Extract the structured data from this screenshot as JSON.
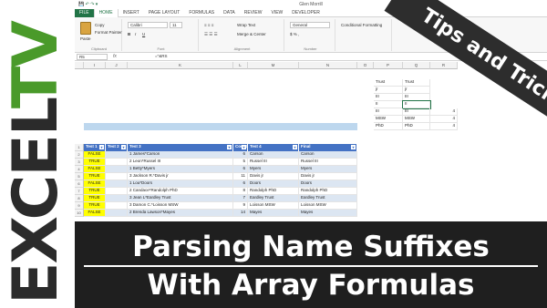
{
  "brand": {
    "excel": "EXCEL",
    "tv": "TV",
    "colors": {
      "excel": "#2b2b2b",
      "tv": "#4a9a2a"
    }
  },
  "window": {
    "title": "Glen Morrill",
    "user": "Christy Sellell",
    "file_tab": "FILE",
    "tabs": [
      "HOME",
      "INSERT",
      "PAGE LAYOUT",
      "FORMULAS",
      "DATA",
      "REVIEW",
      "VIEW",
      "DEVELOPER"
    ],
    "active_tab": "HOME",
    "accent_color": "#217346"
  },
  "ribbon": {
    "clipboard": {
      "label": "Clipboard",
      "paste": "Paste",
      "copy": "Copy",
      "format_painter": "Format Painter"
    },
    "font": {
      "label": "Font",
      "name": "Calibri",
      "size": "11"
    },
    "alignment": {
      "label": "Alignment",
      "wrap_text": "Wrap Text",
      "merge_center": "Merge & Center"
    },
    "number": {
      "label": "Number",
      "format": "General"
    },
    "styles": {
      "conditional": "Conditional Formatting",
      "format_as_table": "Format as Table",
      "cell_styles": "Cell Styles",
      "table_tools": "TABLE TOOLS"
    },
    "cells": {
      "insert": "Insert",
      "delete": "Delete",
      "format": "Format"
    },
    "editing": {
      "label": "Editing",
      "autosum": "AutoSum",
      "fill": "Fill",
      "clear": "Clear",
      "sort_filter": "Sort & Filter",
      "find_select": "Find & Select"
    }
  },
  "formula_bar": {
    "name_box": "R5",
    "fx": "fx",
    "formula": "=\"&RS"
  },
  "columns": [
    "I",
    "J",
    "K",
    "L",
    "M",
    "N",
    "O",
    "P",
    "Q",
    "R"
  ],
  "rows": [
    "1",
    "2",
    "3",
    "4",
    "5",
    "6",
    "7",
    "8",
    "9",
    "10",
    "11",
    "12",
    "13",
    "14",
    "15"
  ],
  "table_rows": [
    "1",
    "2",
    "3",
    "4",
    "5",
    "6",
    "7",
    "8",
    "9",
    "10",
    "11"
  ],
  "lookup": {
    "header": "Trust",
    "left": [
      "Trust",
      "jr",
      "III",
      "II",
      "III",
      "MSW",
      "PhD"
    ],
    "right": [
      "Trust",
      "jr",
      "III",
      "II",
      "III",
      "MSW",
      "PhD"
    ],
    "counts": [
      "",
      "",
      "",
      "",
      "4",
      "4",
      "4"
    ]
  },
  "table": {
    "headers": [
      "Test 1",
      "Test 2",
      "Test 3",
      "Count",
      "Test 4",
      "Final"
    ],
    "rows": [
      [
        "FALSE",
        "",
        "1 James*Carson",
        "6",
        "Carson",
        "Carson"
      ],
      [
        "TRUE",
        "",
        "2 Leon*Russel III",
        "5",
        "Russel III",
        "Russel III"
      ],
      [
        "FALSE",
        "",
        "1 Betty*Myers",
        "6",
        "Myers",
        "Myers"
      ],
      [
        "TRUE",
        "",
        "3 Jackson R.*Davis jr",
        "11",
        "Davis jr",
        "Davis jr"
      ],
      [
        "FALSE",
        "",
        "1 Lou*Doors",
        "6",
        "Doors",
        "Doors"
      ],
      [
        "TRUE",
        "",
        "2 Candace*Randolph PhD",
        "8",
        "Randolph PhD",
        "Randolph PhD"
      ],
      [
        "TRUE",
        "",
        "3 Jean L*Eardley Trust",
        "7",
        "Eardley Trust",
        "Eardley Trust"
      ],
      [
        "TRUE",
        "",
        "3 Damon C.*Loisson MSW",
        "9",
        "Loisson MSW",
        "Loisson MSW"
      ],
      [
        "FALSE",
        "",
        "2 Brenda Lawson*Mayes",
        "14",
        "Mayes",
        "Mayes"
      ]
    ]
  },
  "overlay": {
    "tips": "Tips and Tricks",
    "title_line1": "Parsing Name Suffixes",
    "title_line2": "With Array Formulas"
  }
}
